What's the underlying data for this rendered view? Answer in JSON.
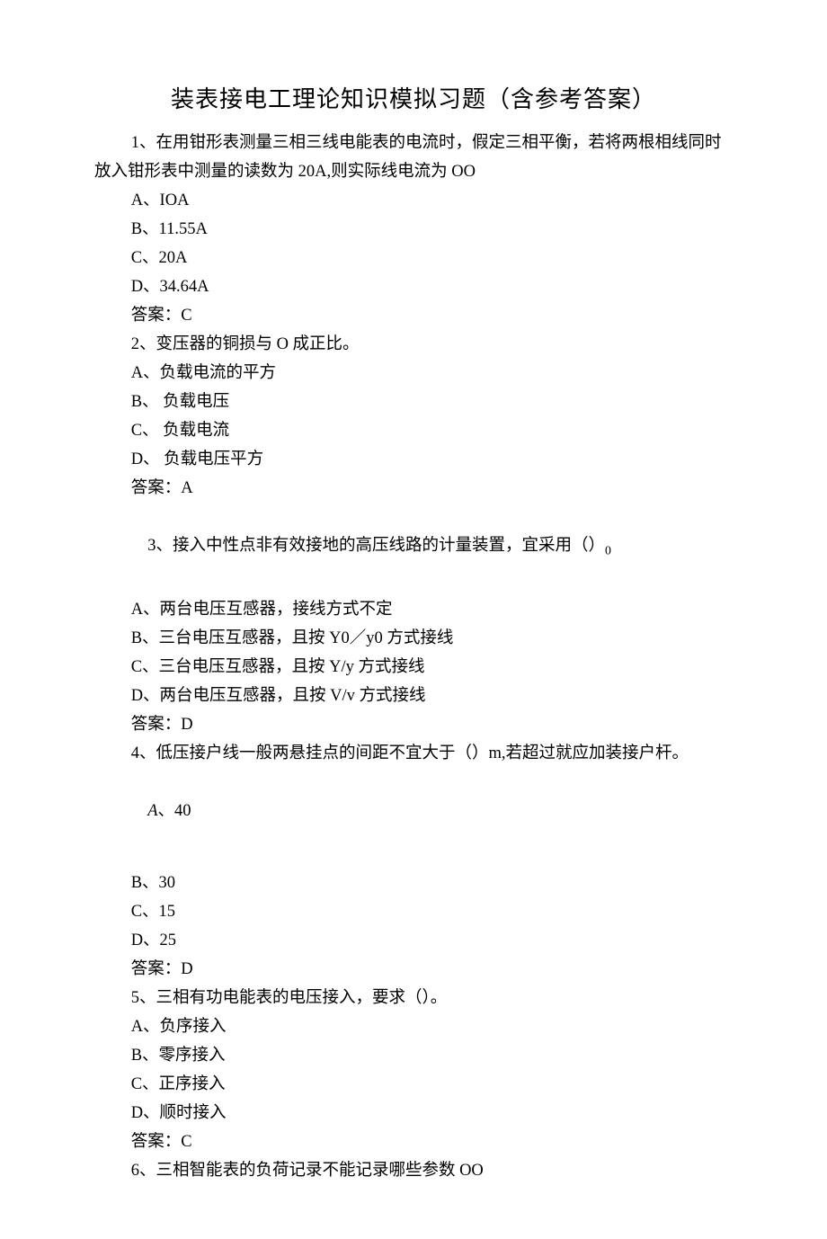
{
  "title": "装表接电工理论知识模拟习题（含参考答案）",
  "q1": {
    "stem": "1、在用钳形表测量三相三线电能表的电流时，假定三相平衡，若将两根相线同时放入钳形表中测量的读数为 20A,则实际线电流为 OO",
    "a": "A、IOA",
    "b": "B、11.55A",
    "c": "C、20A",
    "d": "D、34.64A",
    "ans": "答案：C"
  },
  "q2": {
    "stem": "2、变压器的铜损与 O 成正比。",
    "a": "A、负载电流的平方",
    "b": "B、 负载电压",
    "c": "C、 负载电流",
    "d": "D、 负载电压平方",
    "ans": "答案：A"
  },
  "q3": {
    "stem_pre": "3、接入中性点非有效接地的高压线路的计量装置，宜采用（）",
    "stem_sub": "0",
    "a": "A、两台电压互感器，接线方式不定",
    "b": "B、三台电压互感器，且按 Y0／y0 方式接线",
    "c": "C、三台电压互感器，且按 Y/y 方式接线",
    "d": "D、两台电压互感器，且按 V/v 方式接线",
    "ans": "答案：D"
  },
  "q4": {
    "stem": "4、低压接户线一般两悬挂点的间距不宜大于（）m,若超过就应加装接户杆。",
    "a_prefix": "A",
    "a_val": "、40",
    "b": "B、30",
    "c": "C、15",
    "d": "D、25",
    "ans": "答案：D"
  },
  "q5": {
    "stem": "5、三相有功电能表的电压接入，要求（）。",
    "a": "A、负序接入",
    "b": "B、零序接入",
    "c": "C、正序接入",
    "d": "D、顺时接入",
    "ans": "答案：C"
  },
  "q6": {
    "stem": "6、三相智能表的负荷记录不能记录哪些参数 OO"
  }
}
